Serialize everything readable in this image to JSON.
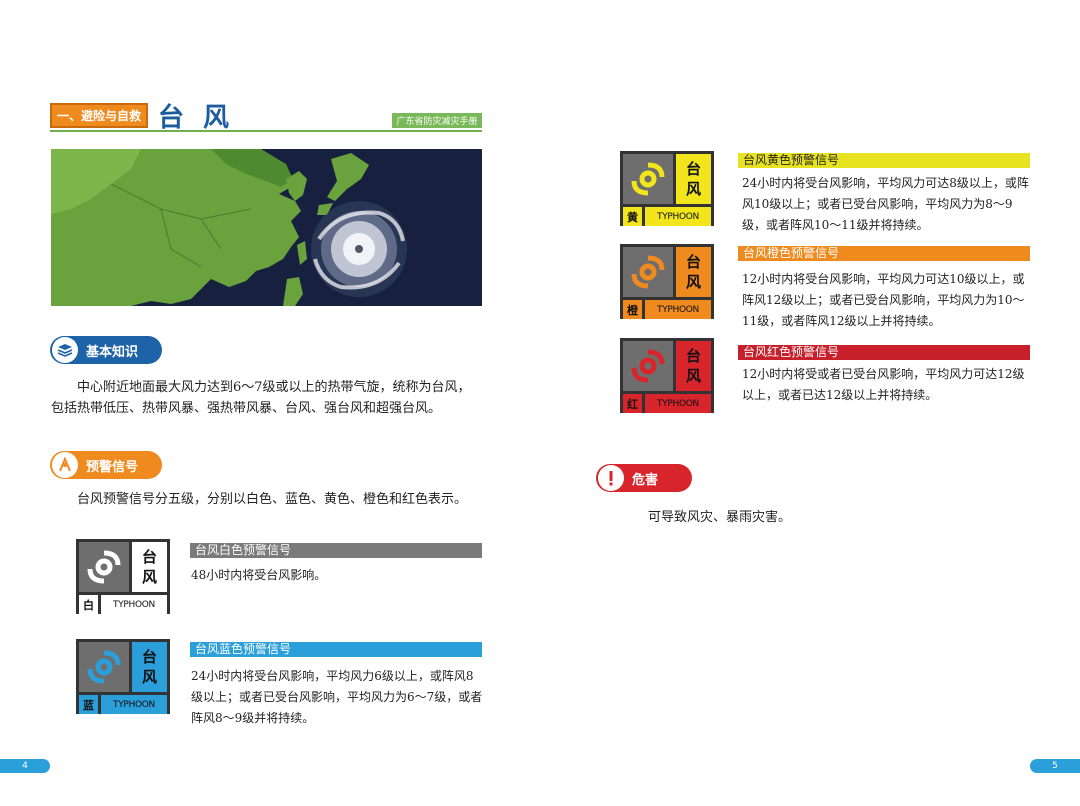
{
  "header": {
    "chapter_tag": "一、避险与自救",
    "title": "台 风",
    "handbook": "广东省防灾减灾手册"
  },
  "basic": {
    "label": "基本知识",
    "text": "中心附近地面最大风力达到6～7级或以上的热带气旋，统称为台风，包括热带低压、热带风暴、强热带风暴、台风、强台风和超强台风。"
  },
  "warning": {
    "label": "预警信号",
    "text": "台风预警信号分五级，分别以白色、蓝色、黄色、橙色和红色表示。"
  },
  "signals": [
    {
      "name": "台风白色预警信号",
      "char1": "台",
      "char2": "风",
      "color_char": "白",
      "eng": "TYPHOON",
      "text": "48小时内将受台风影响。",
      "bar_color": "#7a7a7a",
      "icon_color": "#ffffff",
      "swirl_bg": "#6e6e6e"
    },
    {
      "name": "台风蓝色预警信号",
      "char1": "台",
      "char2": "风",
      "color_char": "蓝",
      "eng": "TYPHOON",
      "text": "24小时内将受台风影响，平均风力6级以上，或阵风8级以上；或者已受台风影响，平均风力为6～7级，或者阵风8～9级并将持续。",
      "bar_color": "#2b9fd9",
      "icon_color": "#2b9fd9",
      "swirl_bg": "#6e6e6e"
    },
    {
      "name": "台风黄色预警信号",
      "char1": "台",
      "char2": "风",
      "color_char": "黄",
      "eng": "TYPHOON",
      "text": "24小时内将受台风影响，平均风力可达8级以上，或阵风10级以上；或者已受台风影响，平均风力为8～9级，或者阵风10～11级并将持续。",
      "bar_color": "#e8e320",
      "icon_color": "#f2e51c",
      "swirl_bg": "#6e6e6e"
    },
    {
      "name": "台风橙色预警信号",
      "char1": "台",
      "char2": "风",
      "color_char": "橙",
      "eng": "TYPHOON",
      "text": "12小时内将受台风影响，平均风力可达10级以上，或阵风12级以上；或者已受台风影响，平均风力为10～11级，或者阵风12级以上并将持续。",
      "bar_color": "#ef8a1f",
      "icon_color": "#ef8a1f",
      "swirl_bg": "#6e6e6e"
    },
    {
      "name": "台风红色预警信号",
      "char1": "台",
      "char2": "风",
      "color_char": "红",
      "eng": "TYPHOON",
      "text": "12小时内将受或者已受台风影响，平均风力可达12级以上，或者已达12级以上并将持续。",
      "bar_color": "#c8202a",
      "icon_color": "#d8252c",
      "swirl_bg": "#6e6e6e"
    }
  ],
  "hazard": {
    "label": "危害",
    "text": "可导致风灾、暴雨灾害。"
  },
  "pages": {
    "left": "4",
    "right": "5"
  }
}
